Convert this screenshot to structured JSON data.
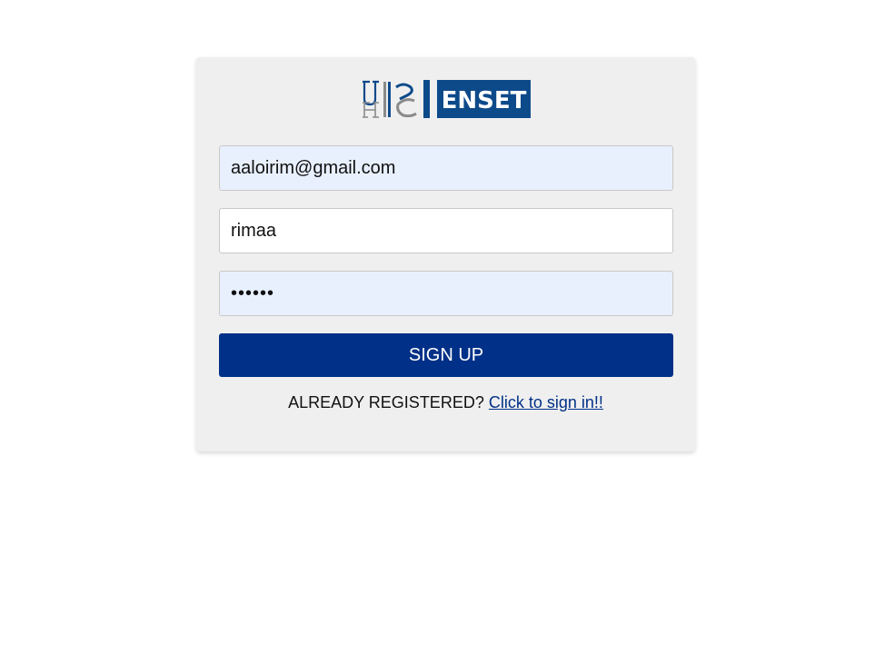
{
  "logo": {
    "text": "ENSET",
    "monogram": "UH2C",
    "colors": {
      "primary": "#0d4a8a",
      "secondary": "#8a8a8a"
    }
  },
  "form": {
    "email_value": "aaloirim@gmail.com",
    "username_value": "rimaa",
    "password_value": "••••••",
    "submit_label": "SIGN UP",
    "already_text": "ALREADY REGISTERED?",
    "signin_link_text": "Click to sign in!!"
  },
  "colors": {
    "accent": "#003087",
    "card_bg": "#efefef",
    "autofill_bg": "#e8f0fe"
  }
}
